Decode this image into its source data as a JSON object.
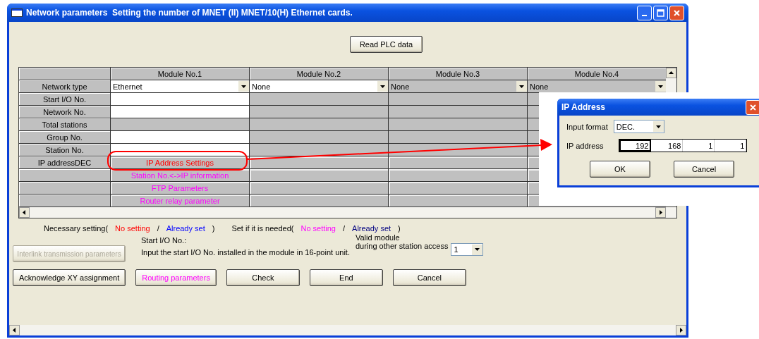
{
  "window": {
    "title": "Network parameters  Setting the number of MNET (II) MNET/10(H) Ethernet cards."
  },
  "read_plc_button": "Read PLC data",
  "table": {
    "columns": [
      "Module No.1",
      "Module No.2",
      "Module No.3",
      "Module No.4"
    ],
    "rows": [
      {
        "label": "Network type",
        "cells": [
          {
            "kind": "dropdown",
            "value": "Ethernet",
            "disabled": false
          },
          {
            "kind": "dropdown",
            "value": "None",
            "disabled": false
          },
          {
            "kind": "dropdown",
            "value": "None",
            "disabled": true
          },
          {
            "kind": "dropdown",
            "value": "None",
            "disabled": true
          }
        ]
      },
      {
        "label": "Start I/O No.",
        "cells": [
          {
            "kind": "input"
          },
          {
            "kind": "blank"
          },
          {
            "kind": "blank"
          },
          {
            "kind": "blank"
          }
        ]
      },
      {
        "label": "Network No.",
        "cells": [
          {
            "kind": "input"
          },
          {
            "kind": "blank"
          },
          {
            "kind": "blank"
          },
          {
            "kind": "blank"
          }
        ]
      },
      {
        "label": "Total stations",
        "cells": [
          {
            "kind": "blank"
          },
          {
            "kind": "blank"
          },
          {
            "kind": "blank"
          },
          {
            "kind": "blank"
          }
        ]
      },
      {
        "label": "Group No.",
        "cells": [
          {
            "kind": "input"
          },
          {
            "kind": "blank"
          },
          {
            "kind": "blank"
          },
          {
            "kind": "blank"
          }
        ]
      },
      {
        "label": "Station No.",
        "cells": [
          {
            "kind": "input"
          },
          {
            "kind": "blank"
          },
          {
            "kind": "blank"
          },
          {
            "kind": "blank"
          }
        ]
      },
      {
        "label": "IP addressDEC",
        "cells": [
          {
            "kind": "button",
            "label": "IP Address Settings",
            "color": "#ff0000"
          },
          {
            "kind": "button"
          },
          {
            "kind": "button"
          },
          {
            "kind": "button"
          }
        ]
      },
      {
        "cells": [
          {
            "kind": "button",
            "label": "Station No.<->IP information",
            "color": "#ff00ff"
          },
          {
            "kind": "button"
          },
          {
            "kind": "button"
          },
          {
            "kind": "button"
          }
        ]
      },
      {
        "cells": [
          {
            "kind": "button",
            "label": "FTP Parameters",
            "color": "#ff00ff"
          },
          {
            "kind": "button"
          },
          {
            "kind": "button"
          },
          {
            "kind": "button"
          }
        ]
      },
      {
        "cells": [
          {
            "kind": "button",
            "label": "Router relay parameter",
            "color": "#ff00ff"
          },
          {
            "kind": "button"
          },
          {
            "kind": "button"
          },
          {
            "kind": "button"
          }
        ]
      }
    ]
  },
  "legend": [
    {
      "text": "Necessary setting("
    },
    {
      "text": "No setting",
      "color": "#ff0000"
    },
    {
      "text": "/"
    },
    {
      "text": "Already set",
      "color": "#0000ff"
    },
    {
      "text": ")"
    },
    {
      "text": "Set if it is needed("
    },
    {
      "text": "No setting",
      "color": "#ff00ff"
    },
    {
      "text": "/"
    },
    {
      "text": "Already set",
      "color": "#000080"
    },
    {
      "text": ")"
    }
  ],
  "help": {
    "title": "Start I/O No.:",
    "text": "Input the start I/O No. installed in the module in 16-point unit."
  },
  "valid_module": {
    "label_lines": [
      "Valid module",
      "during other station access"
    ],
    "value": "1"
  },
  "interlink_button": {
    "label": "Interlink transmission parameters",
    "disabled": true
  },
  "buttons": [
    {
      "label": "Acknowledge XY assignment"
    },
    {
      "label": "Routing parameters",
      "color": "#ff00ff"
    },
    {
      "label": "Check"
    },
    {
      "label": "End"
    },
    {
      "label": "Cancel"
    }
  ],
  "dialog": {
    "title": "IP Address",
    "input_format_label": "Input format",
    "input_format": "DEC.",
    "ip_label": "IP address",
    "octets": [
      "192",
      "168",
      "1",
      "1"
    ],
    "buttons": [
      "OK",
      "Cancel"
    ]
  }
}
